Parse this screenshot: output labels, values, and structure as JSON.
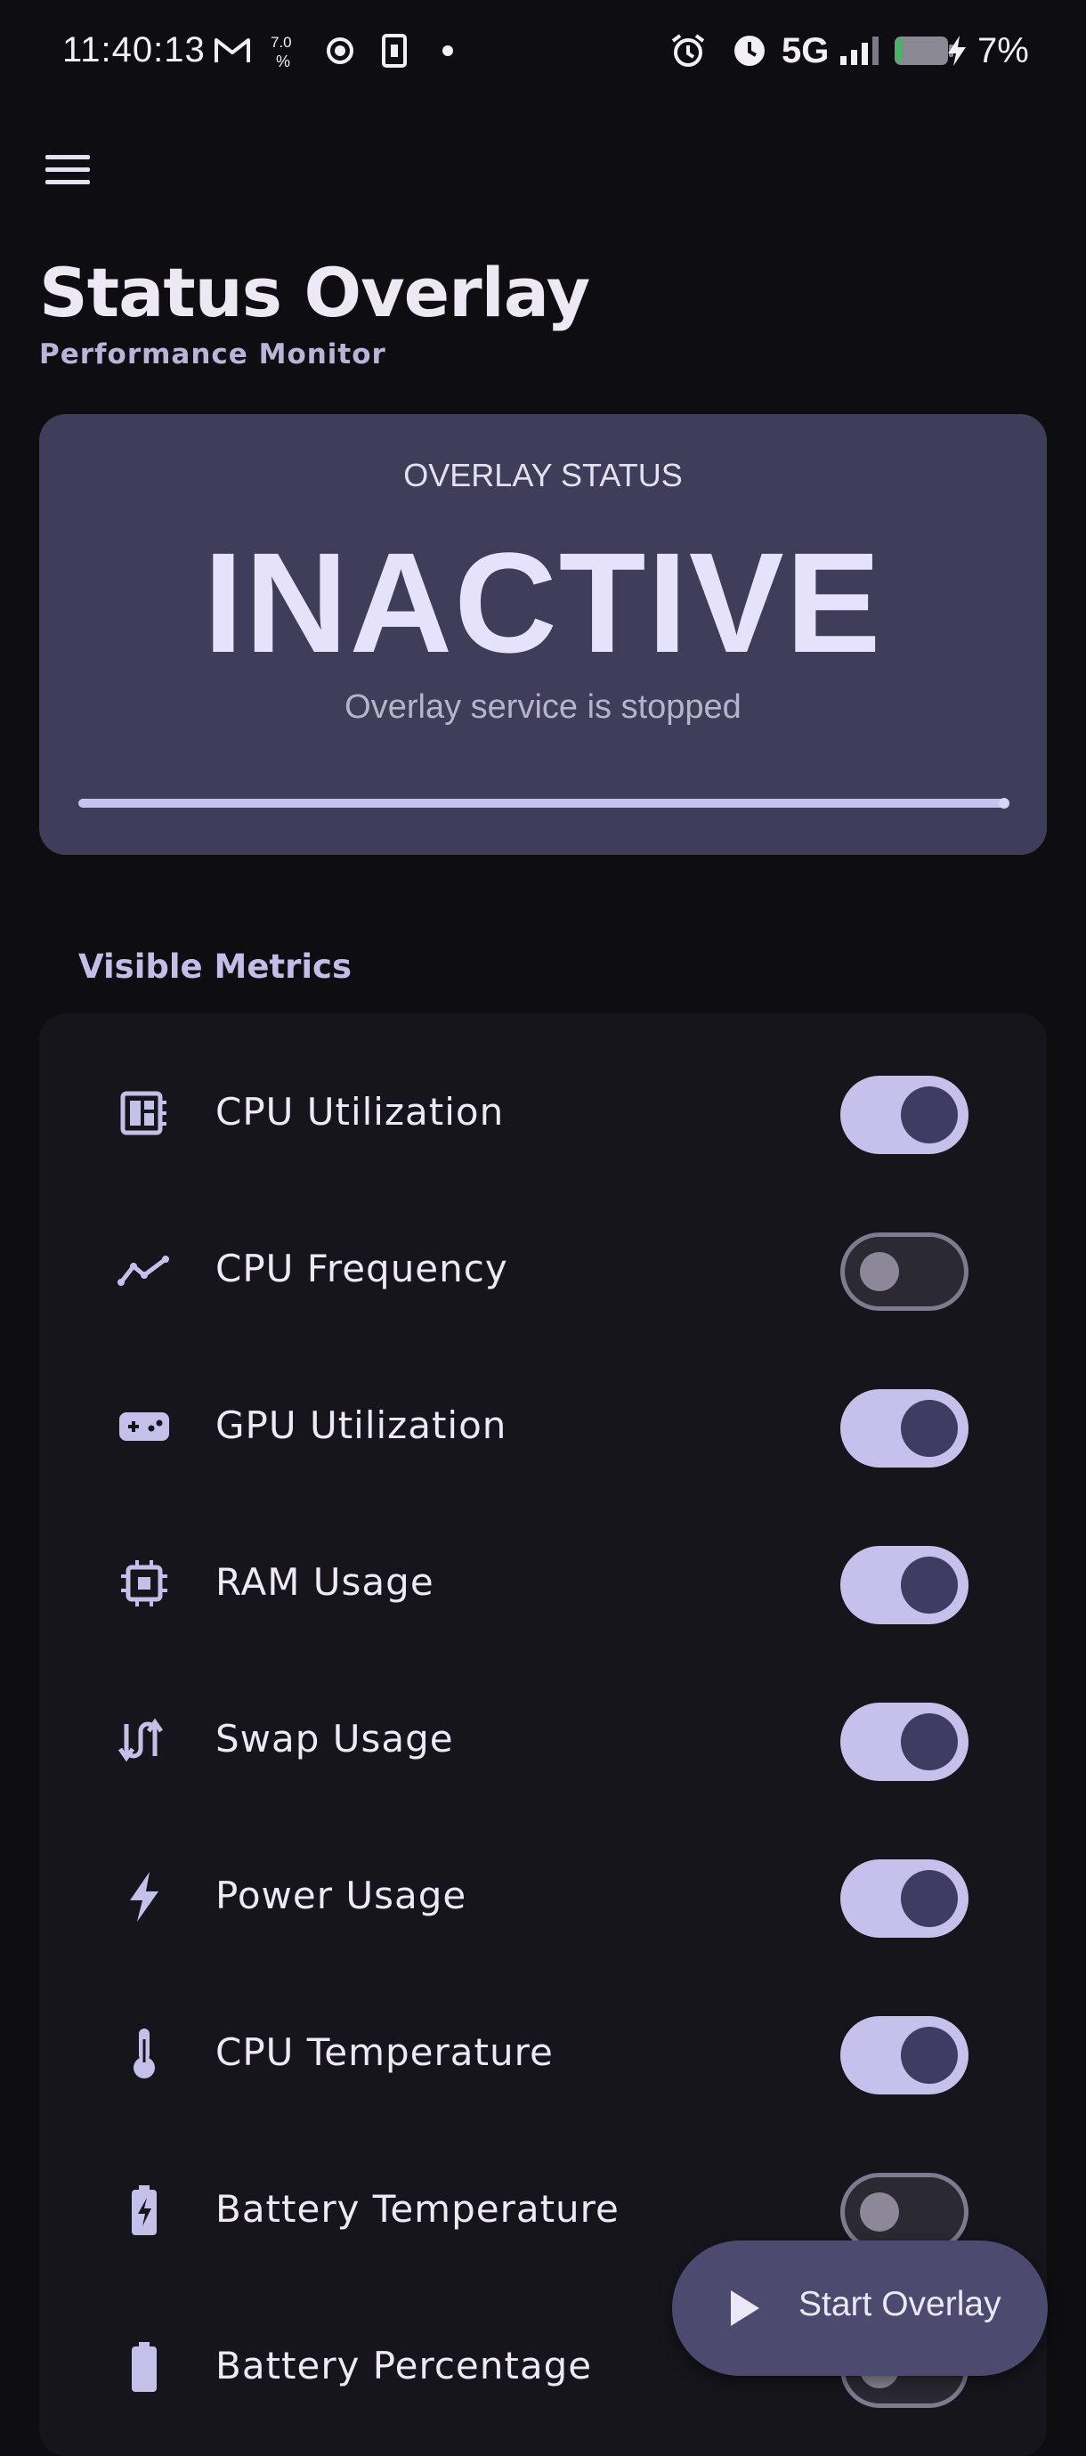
{
  "status_bar": {
    "time": "11:40:13",
    "network": "5G",
    "battery_percent": "7%",
    "left_icons": [
      "gmail-icon",
      "data-speed-icon",
      "circle-dot-icon",
      "sim-icon",
      "dot-icon"
    ],
    "right_icons": [
      "alarm-icon",
      "clock-icon",
      "signal-icon",
      "battery-icon",
      "charging-bolt-icon"
    ]
  },
  "header": {
    "menu_icon": "hamburger-menu-icon",
    "title": "Status Overlay",
    "subtitle": "Performance Monitor"
  },
  "status_card": {
    "label": "OVERLAY STATUS",
    "value": "INACTIVE",
    "description": "Overlay service is stopped",
    "progress_fraction": 1.0
  },
  "metrics": {
    "section_title": "Visible Metrics",
    "items": [
      {
        "label": "CPU Utilization",
        "icon": "dashboard-icon",
        "enabled": true
      },
      {
        "label": "CPU Frequency",
        "icon": "trend-line-icon",
        "enabled": false
      },
      {
        "label": "GPU Utilization",
        "icon": "gamepad-icon",
        "enabled": true
      },
      {
        "label": "RAM Usage",
        "icon": "memory-chip-icon",
        "enabled": true
      },
      {
        "label": "Swap Usage",
        "icon": "swap-arrows-icon",
        "enabled": true
      },
      {
        "label": "Power Usage",
        "icon": "bolt-icon",
        "enabled": true
      },
      {
        "label": "CPU Temperature",
        "icon": "thermometer-icon",
        "enabled": true
      },
      {
        "label": "Battery Temperature",
        "icon": "battery-charging-icon",
        "enabled": false
      },
      {
        "label": "Battery Percentage",
        "icon": "battery-full-icon",
        "enabled": false
      }
    ]
  },
  "fab": {
    "label": "Start Overlay",
    "icon": "play-icon"
  },
  "colors": {
    "background": "#0e0d12",
    "card": "#3f3d59",
    "accent": "#c6c1ec",
    "fab": "#4c4a6e"
  }
}
